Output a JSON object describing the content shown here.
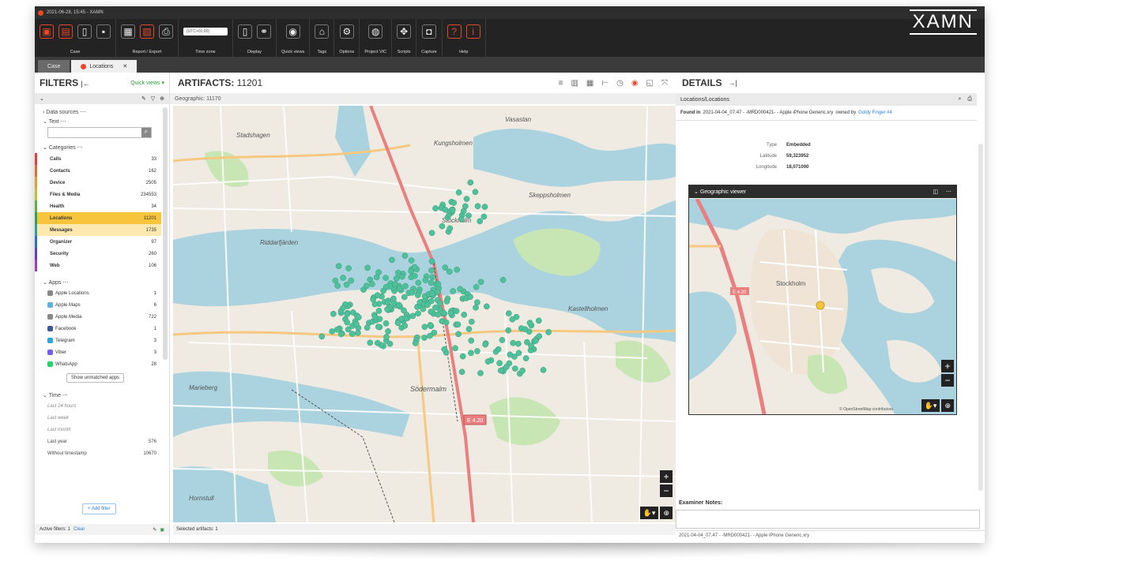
{
  "window": {
    "title": "2021-06-28, 15:45 - XAMN",
    "logo": "XAMN"
  },
  "ribbon": {
    "groups": [
      {
        "label": "Case"
      },
      {
        "label": "Report / Export"
      },
      {
        "label": "Time zone",
        "tz_value": "(UTC+01:00)"
      },
      {
        "label": "Display"
      },
      {
        "label": "Quick views"
      },
      {
        "label": "Tags"
      },
      {
        "label": "Options"
      },
      {
        "label": "Project VIC"
      },
      {
        "label": "Scripts"
      },
      {
        "label": "Capture"
      },
      {
        "label": "Help"
      }
    ]
  },
  "tabs": {
    "case": "Case",
    "locations": "Locations"
  },
  "filters": {
    "title": "FILTERS",
    "quick_views": "Quick views",
    "data_sources": "Data sources",
    "text": "Text",
    "categories_label": "Categories",
    "categories": [
      {
        "name": "Calls",
        "count": "33",
        "color": "#e04040"
      },
      {
        "name": "Contacts",
        "count": "162",
        "color": "#e07030"
      },
      {
        "name": "Device",
        "count": "2505",
        "color": "#e0a030"
      },
      {
        "name": "Files & Media",
        "count": "234553",
        "color": "#c0c030"
      },
      {
        "name": "Health",
        "count": "34",
        "color": "#60b040"
      },
      {
        "name": "Locations",
        "count": "11201",
        "color": "#30a060"
      },
      {
        "name": "Messages",
        "count": "1735",
        "color": "#30a0a0"
      },
      {
        "name": "Organizer",
        "count": "97",
        "color": "#3070c0"
      },
      {
        "name": "Security",
        "count": "260",
        "color": "#6040c0"
      },
      {
        "name": "Web",
        "count": "106",
        "color": "#a040b0"
      }
    ],
    "apps_label": "Apps",
    "apps": [
      {
        "name": "Apple Locations",
        "count": "1",
        "color": "#888888"
      },
      {
        "name": "Apple Maps",
        "count": "6",
        "color": "#5fb0e0"
      },
      {
        "name": "Apple Media",
        "count": "722",
        "color": "#888888"
      },
      {
        "name": "Facebook",
        "count": "1",
        "color": "#3b5998"
      },
      {
        "name": "Telegram",
        "count": "3",
        "color": "#2ca5e0"
      },
      {
        "name": "Viber",
        "count": "3",
        "color": "#7360f2"
      },
      {
        "name": "WhatsApp",
        "count": "28",
        "color": "#25d366"
      }
    ],
    "show_unmatched": "Show unmatched apps",
    "time_label": "Time",
    "time_items": [
      {
        "name": "Last 24 hours",
        "count": ""
      },
      {
        "name": "Last week",
        "count": ""
      },
      {
        "name": "Last month",
        "count": ""
      },
      {
        "name": "Last year",
        "count": "576"
      },
      {
        "name": "Without timestamp",
        "count": "10670"
      }
    ],
    "add_filter": "+ Add filter",
    "active_filters": "Active filters: 1",
    "clear": "Clear"
  },
  "artifacts": {
    "title": "ARTIFACTS:",
    "count": "11201",
    "geographic": "Geographic: 11170",
    "selected": "Selected artifacts: 1",
    "map_labels": [
      "Stockholm",
      "Kungsholmen",
      "Riddarfjärden",
      "Södermalm",
      "Skeppsholmen",
      "Kastellholmen",
      "Stadshagen",
      "Vasastan",
      "Marieberg",
      "Hornstull"
    ],
    "route_label": "E 4.20"
  },
  "details": {
    "title": "DETAILS",
    "path": "Locations/Locations",
    "found_in_label": "Found in",
    "found_in_value": "2021-04-04_07.47 - -MRD000421- - Apple iPhone Generic.xry",
    "owned_by": "owned by",
    "owner": "Goldy Finger #4",
    "properties": [
      {
        "key": "Type",
        "value": "Embedded"
      },
      {
        "key": "Latitude",
        "value": "59,323952"
      },
      {
        "key": "Longitude",
        "value": "18,071000"
      }
    ],
    "geo_viewer_title": "Geographic viewer",
    "geo_map_label": "Stockholm",
    "geo_route_label": "E 4.20",
    "attribution": "© OpenStreetMap contributors",
    "examiner_notes": "Examiner Notes:",
    "footer": "2021-04-04_07.47 - -MRD000421- - Apple iPhone Generic.xry"
  },
  "colors": {
    "accent": "#e8472a",
    "point": "#4fc19a",
    "water": "#aad3df",
    "park": "#c8e6b4",
    "road": "#f7c87f",
    "highway": "#e98080"
  }
}
